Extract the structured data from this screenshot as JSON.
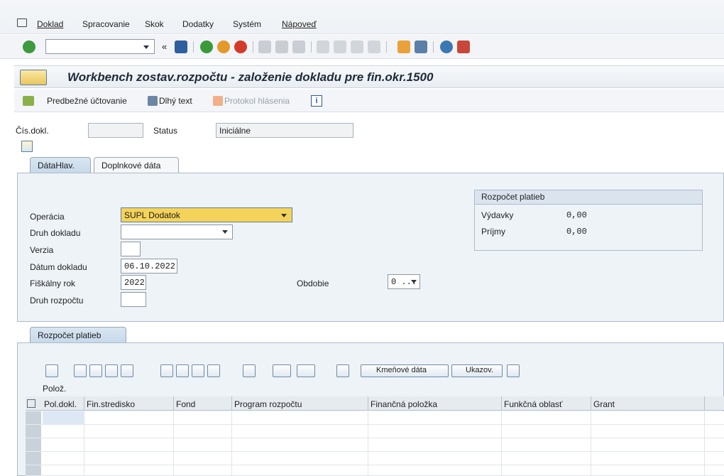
{
  "menu": {
    "items": [
      "Doklad",
      "Spracovanie",
      "Skok",
      "Dodatky",
      "Systém",
      "Nápoveď"
    ]
  },
  "title": "Workbench zostav.rozpočtu - založenie dokladu pre fin.okr.1500",
  "app_toolbar": {
    "predbezne": "Predbežné účtovanie",
    "dlhy_text": "Dlhý text",
    "protokol": "Protokol hlásenia"
  },
  "header_fields": {
    "cis_dokl_label": "Čís.dokl.",
    "cis_dokl_value": "",
    "status_label": "Status",
    "status_value": "Iniciálne"
  },
  "tabs": [
    "DátaHlav.",
    "Doplnkové dáta"
  ],
  "form": {
    "operacia_label": "Operácia",
    "operacia_value": "SUPL Dodatok",
    "druh_dokladu_label": "Druh dokladu",
    "druh_dokladu_value": "",
    "verzia_label": "Verzia",
    "verzia_value": "",
    "datum_label": "Dátum dokladu",
    "datum_value": "06.10.2022",
    "fiskalny_label": "Fiškálny rok",
    "fiskalny_value": "2022",
    "druh_rozpoctu_label": "Druh rozpočtu",
    "druh_rozpoctu_value": "",
    "obdobie_label": "Obdobie",
    "obdobie_value": "0 ..."
  },
  "rozpocet": {
    "title": "Rozpočet platieb",
    "vydavky_label": "Výdavky",
    "vydavky_value": "0,00",
    "prijmy_label": "Príjmy",
    "prijmy_value": "0,00"
  },
  "lower_tab": "Rozpočet platieb",
  "grid_toolbar": {
    "kmenove": "Kmeňové dáta",
    "ukazov": "Ukazov."
  },
  "poloz_label": "Polož.",
  "table": {
    "columns": [
      "Pol.dokl.",
      "Fin.stredisko",
      "Fond",
      "Program rozpočtu",
      "Finančná položka",
      "Funkčná oblasť",
      "Grant"
    ]
  },
  "colors": {
    "accent": "#f5d35a",
    "panel": "#eef3f8"
  }
}
